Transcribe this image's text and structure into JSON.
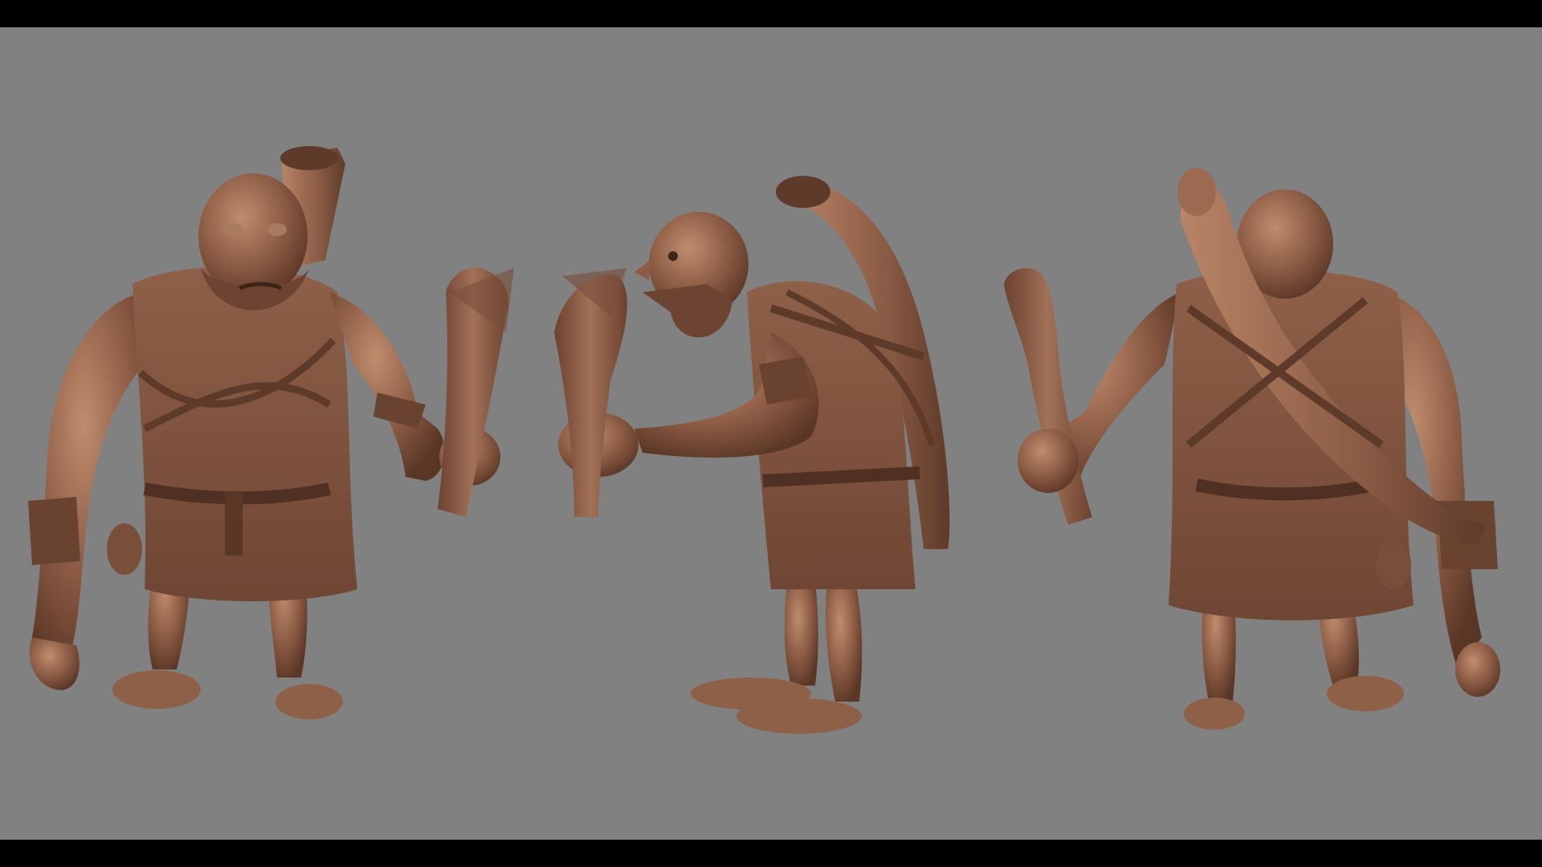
{
  "scene": {
    "background_color": "#818181",
    "letterbox_color": "#000000",
    "clay_color": "#8a5a44",
    "clay_shadow_color": "#5a3626",
    "clay_highlight_color": "#b98466",
    "views": [
      {
        "name": "front-view",
        "object": "sculpted-caveman-figure"
      },
      {
        "name": "side-view",
        "object": "sculpted-caveman-figure"
      },
      {
        "name": "back-view",
        "object": "sculpted-caveman-figure"
      }
    ]
  }
}
